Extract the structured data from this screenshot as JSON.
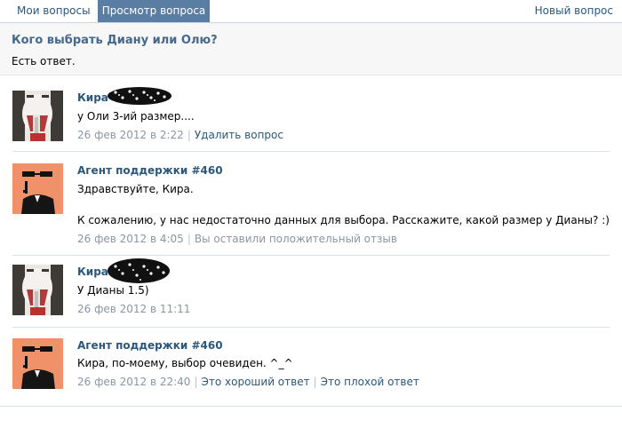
{
  "tabs": {
    "my_questions": "Мои вопросы",
    "view_question": "Просмотр вопроса",
    "new_question": "Новый вопрос"
  },
  "question": {
    "title": "Кого выбрать Диану или Олю?",
    "status": "Есть ответ."
  },
  "messages": [
    {
      "author": "Кира",
      "text": "у Оли 3-ий размер....",
      "date": "26 фев 2012 в 2:22",
      "actions": [
        "Удалить вопрос"
      ]
    },
    {
      "author": "Агент поддержки #460",
      "text": "Здравствуйте, Кира.",
      "text2": "К сожалению, у нас недостаточно данных для выбора. Расскажите, какой размер у Дианы? :)",
      "date": "26 фев 2012 в 4:05",
      "note": "Вы оставили положительный отзыв"
    },
    {
      "author": "Кира",
      "text": "У Дианы 1.5)",
      "date": "26 фев 2012 в 11:11"
    },
    {
      "author": "Агент поддержки #460",
      "text": "Кира, по-моему, выбор очевиден. ^_^",
      "date": "26 фев 2012 в 22:40",
      "actions": [
        "Это хороший ответ",
        "Это плохой ответ"
      ]
    }
  ],
  "colors": {
    "link": "#2b587a",
    "active_tab": "#597da3",
    "meta": "#8b96a3",
    "agent_avatar_bg": "#f0916a"
  },
  "icons": {
    "user_avatar": "joker-face-avatar",
    "agent_avatar": "agent-in-sunglasses-avatar"
  }
}
